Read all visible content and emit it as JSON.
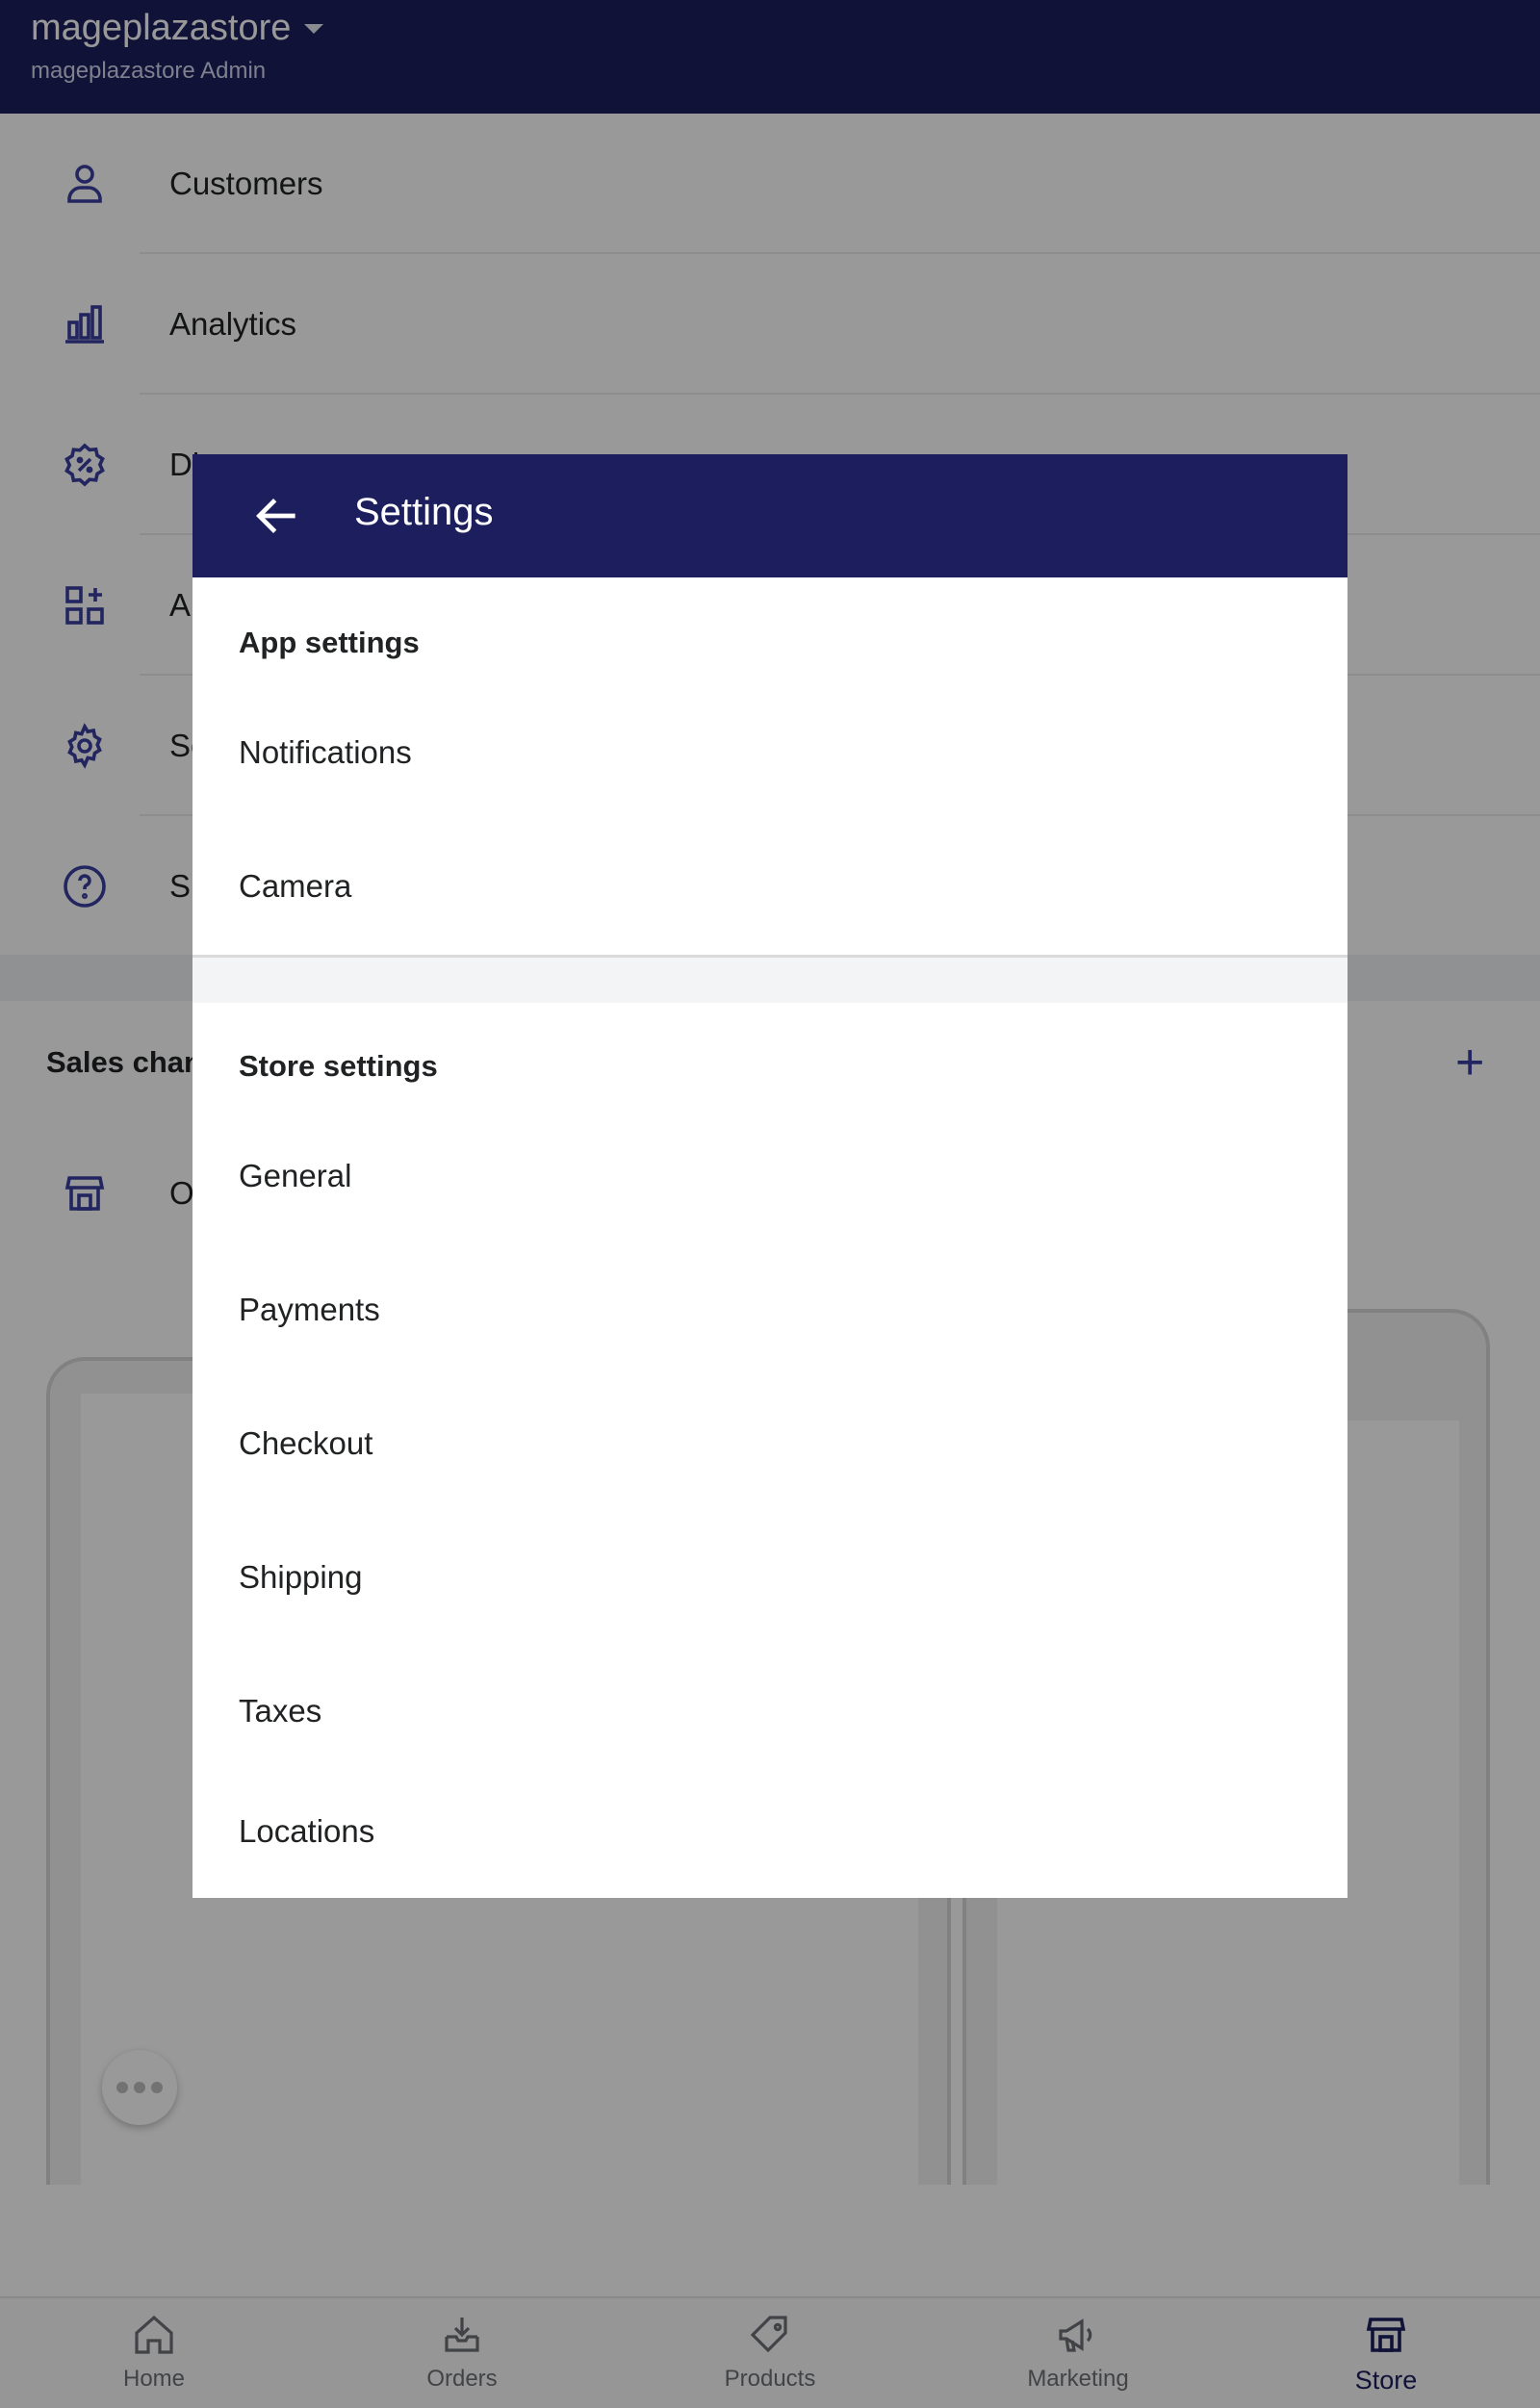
{
  "app_bar": {
    "store_name": "mageplazastore",
    "subtitle": "mageplazastore Admin"
  },
  "menu": {
    "items": [
      {
        "label": "Customers",
        "icon": "person-icon"
      },
      {
        "label": "Analytics",
        "icon": "bar-chart-icon"
      },
      {
        "label": "Di",
        "icon": "discount-icon"
      },
      {
        "label": "Ap",
        "icon": "apps-icon"
      },
      {
        "label": "Se",
        "icon": "gear-icon"
      },
      {
        "label": "Su",
        "icon": "help-icon"
      }
    ]
  },
  "sales_channels": {
    "title": "Sales chan",
    "add_icon": "plus-icon",
    "online_label": "O"
  },
  "dialog": {
    "title": "Settings",
    "back_icon": "back-arrow-icon",
    "app_settings": {
      "heading": "App settings",
      "items": [
        "Notifications",
        "Camera"
      ]
    },
    "store_settings": {
      "heading": "Store settings",
      "items": [
        "General",
        "Payments",
        "Checkout",
        "Shipping",
        "Taxes",
        "Locations"
      ]
    }
  },
  "bottom_nav": {
    "items": [
      {
        "label": "Home",
        "icon": "home-icon",
        "active": false
      },
      {
        "label": "Orders",
        "icon": "orders-icon",
        "active": false
      },
      {
        "label": "Products",
        "icon": "tag-icon",
        "active": false
      },
      {
        "label": "Marketing",
        "icon": "megaphone-icon",
        "active": false
      },
      {
        "label": "Store",
        "icon": "store-icon",
        "active": true
      }
    ]
  },
  "colors": {
    "brand": "#1c1e5e",
    "icon_accent": "#3a3f9e"
  }
}
